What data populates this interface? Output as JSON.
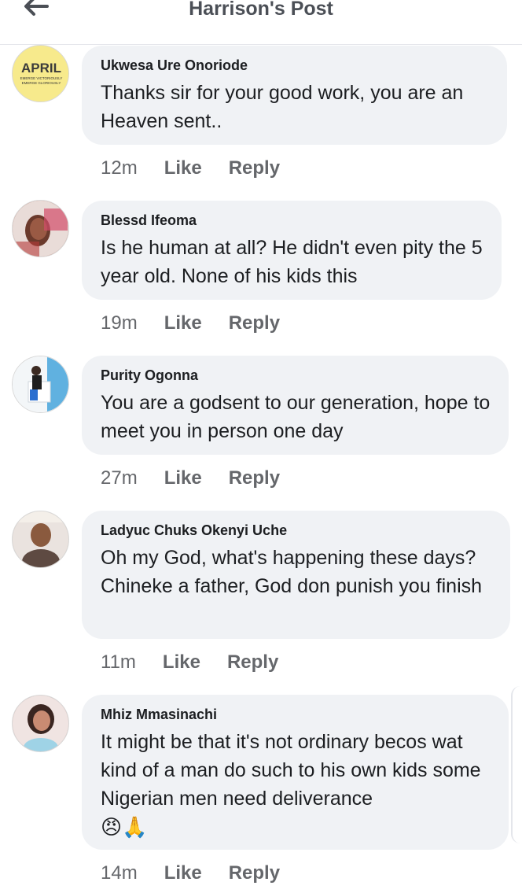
{
  "header": {
    "title": "Harrison's Post",
    "back_icon": "arrow-left-icon"
  },
  "avatar_badge": {
    "line1": "APRIL",
    "line2": "EMERGE VICTORIOUSLY",
    "line3": "EMERGE GLORIOUSLY"
  },
  "actions": {
    "like": "Like",
    "reply": "Reply"
  },
  "comments": [
    {
      "name": "Ukwesa Ure Onoriode",
      "text": "Thanks sir for your good work, you are an Heaven sent..",
      "time": "12m"
    },
    {
      "name": "Blessd Ifeoma",
      "text": "Is he human at all? He didn't even pity the 5 year old. None of his kids this",
      "time": "19m"
    },
    {
      "name": "Purity Ogonna",
      "text": "You are a godsent to our generation, hope to meet you in person one day",
      "time": "27m"
    },
    {
      "name": "Ladyuc Chuks Okenyi Uche",
      "text": "Oh my God, what's happening these days? Chineke a father, God don punish you finish",
      "time": "11m"
    },
    {
      "name": "Mhiz Mmasinachi",
      "text": "It might be that it's not ordinary becos wat kind of a man do such to his own kids some Nigerian men need deliverance",
      "emojis": "😠🙏",
      "time": "14m"
    }
  ]
}
